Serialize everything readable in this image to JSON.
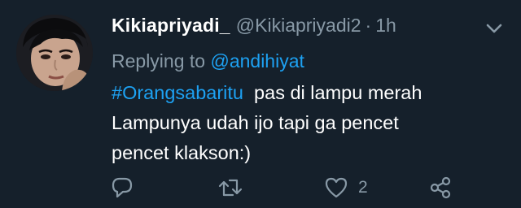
{
  "tweet": {
    "display_name": "Kikiapriyadi_",
    "handle": "@Kikiapriyadi2",
    "separator": "·",
    "time": "1h",
    "replying_prefix": "Replying to",
    "replying_to": "@andihiyat",
    "hashtag": "#Orangsabaritu",
    "line1_rest": "  pas di lampu merah",
    "line2": "Lampunya  udah ijo tapi ga pencet",
    "line3": "pencet klakson:)"
  },
  "actions": {
    "like_count": "2",
    "icons": [
      "reply-icon",
      "retweet-icon",
      "like-icon",
      "share-icon"
    ]
  },
  "colors": {
    "background": "#15202b",
    "text": "#ffffff",
    "muted": "#8899a6",
    "link": "#1da1f2"
  }
}
